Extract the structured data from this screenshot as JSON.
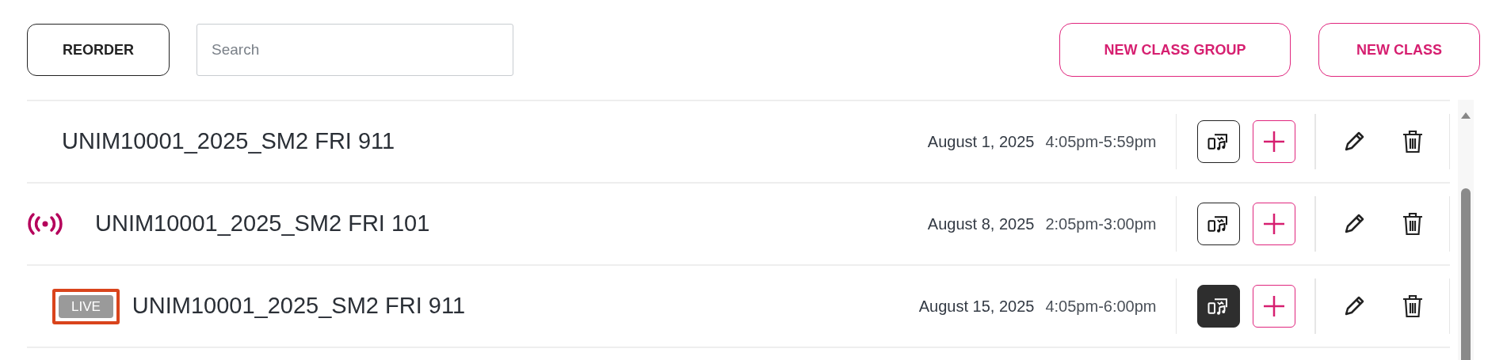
{
  "toolbar": {
    "reorder_button": "REORDER",
    "search": {
      "placeholder": "Search"
    },
    "new_class_group_button": "NEW CLASS GROUP",
    "new_class_button": "NEW CLASS"
  },
  "classes": [
    {
      "name": "UNIM10001_2025_SM2 FRI 911",
      "kind": "plain",
      "date": "August 1, 2025",
      "time": "4:05pm-5:59pm",
      "media_selected": false
    },
    {
      "name": "UNIM10001_2025_SM2 FRI 101",
      "kind": "broadcasting",
      "date": "August 8, 2025",
      "time": "2:05pm-3:00pm",
      "media_selected": false
    },
    {
      "name": "UNIM10001_2025_SM2 FRI 911",
      "kind": "live",
      "badge": "LIVE",
      "date": "August 15, 2025",
      "time": "4:05pm-6:00pm",
      "media_selected": true
    }
  ]
}
